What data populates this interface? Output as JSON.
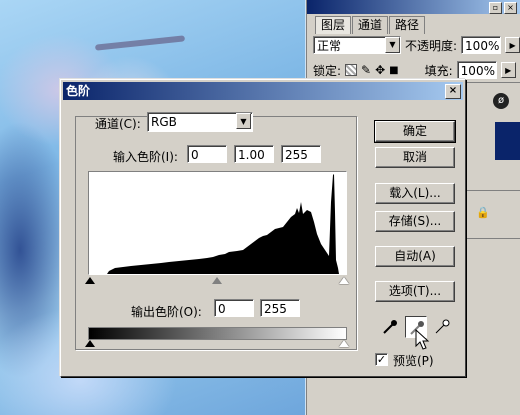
{
  "layers_panel": {
    "tabs": [
      "图层",
      "通道",
      "路径"
    ],
    "blend_mode": "正常",
    "opacity_label": "不透明度:",
    "opacity_value": "100%",
    "lock_label": "锁定:",
    "fill_label": "填充:",
    "fill_value": "100%"
  },
  "levels": {
    "title": "色阶",
    "channel_label": "通道(C):",
    "channel_value": "RGB",
    "input_label": "输入色阶(I):",
    "input_values": [
      "0",
      "1.00",
      "255"
    ],
    "output_label": "输出色阶(O):",
    "output_values": [
      "0",
      "255"
    ],
    "buttons": {
      "ok": "确定",
      "cancel": "取消",
      "load": "载入(L)...",
      "save": "存储(S)...",
      "auto": "自动(A)",
      "options": "选项(T)..."
    },
    "preview_label": "预览(P)",
    "preview_checked": true
  },
  "colors": {
    "titlebar_start": "#0a246a",
    "titlebar_end": "#a6caf0",
    "dialog_bg": "#d4d0c8"
  }
}
